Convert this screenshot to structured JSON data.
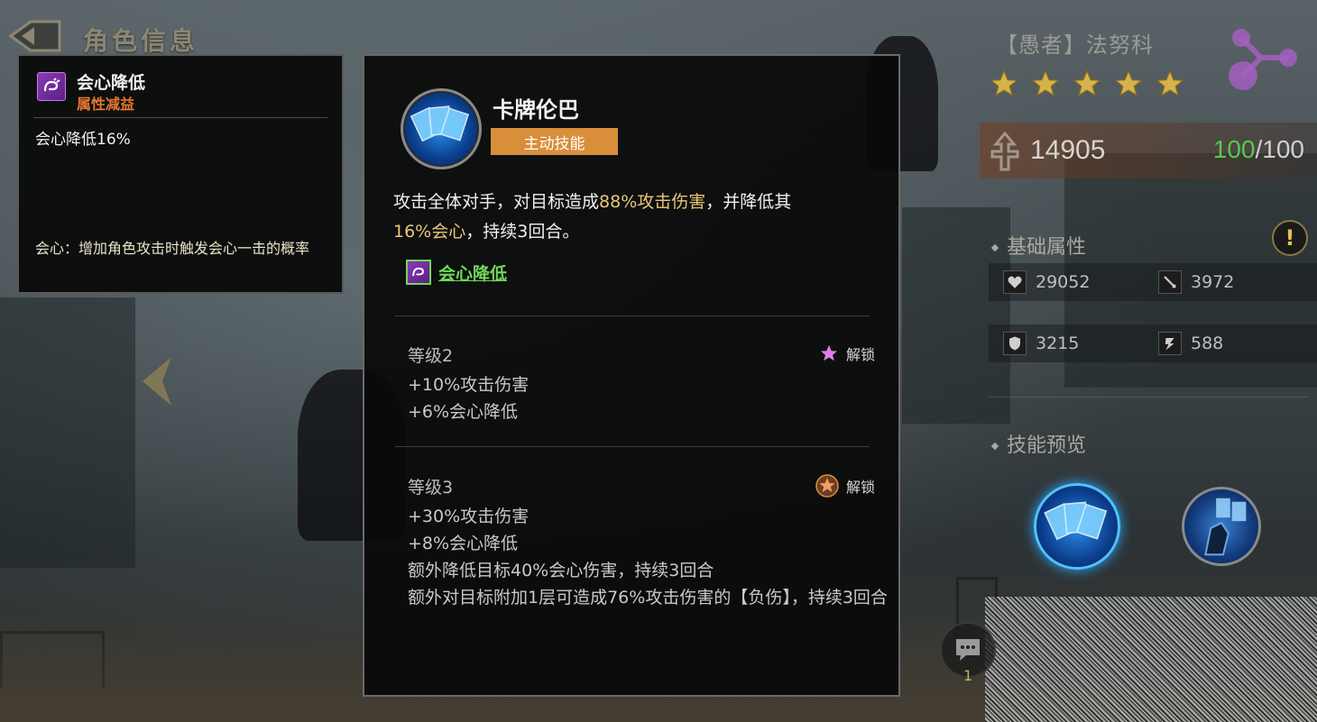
{
  "header": {
    "title": "角色信息"
  },
  "tooltip": {
    "title": "会心降低",
    "subtitle": "属性减益",
    "effect": "会心降低16%",
    "note": "会心：增加角色攻击时触发会心一击的概率"
  },
  "skill": {
    "name": "卡牌伦巴",
    "type": "主动技能",
    "desc_1": "攻击全体对手，对目标造成",
    "desc_hl_1": "88%攻击伤害",
    "desc_2": "，并降低其",
    "desc_hl_2": "16%会心",
    "desc_3": "，持续3回合。",
    "debuff_link": "会心降低",
    "levels": [
      {
        "name": "等级2",
        "unlock": "解锁",
        "lines": [
          "+10%攻击伤害",
          "+6%会心降低"
        ]
      },
      {
        "name": "等级3",
        "unlock": "解锁",
        "lines": [
          "+30%攻击伤害",
          "+8%会心降低",
          "额外降低目标40%会心伤害，持续3回合",
          "额外对目标附加1层可造成76%攻击伤害的【负伤】，持续3回合"
        ]
      }
    ]
  },
  "hero": {
    "name": "【愚者】法努科",
    "stars": 5,
    "power": "14905",
    "hp_current": "100",
    "hp_max": "/100"
  },
  "attributes": {
    "title": "基础属性",
    "hp": "29052",
    "attack": "3972",
    "defense": "3215",
    "speed": "588"
  },
  "skill_preview": {
    "title": "技能预览"
  },
  "chat": {
    "count": "1"
  },
  "colors": {
    "accent": "#d98e3a",
    "debuff": "#6fd85a",
    "highlight": "#e8c878",
    "debuff_sub": "#e8772e"
  }
}
